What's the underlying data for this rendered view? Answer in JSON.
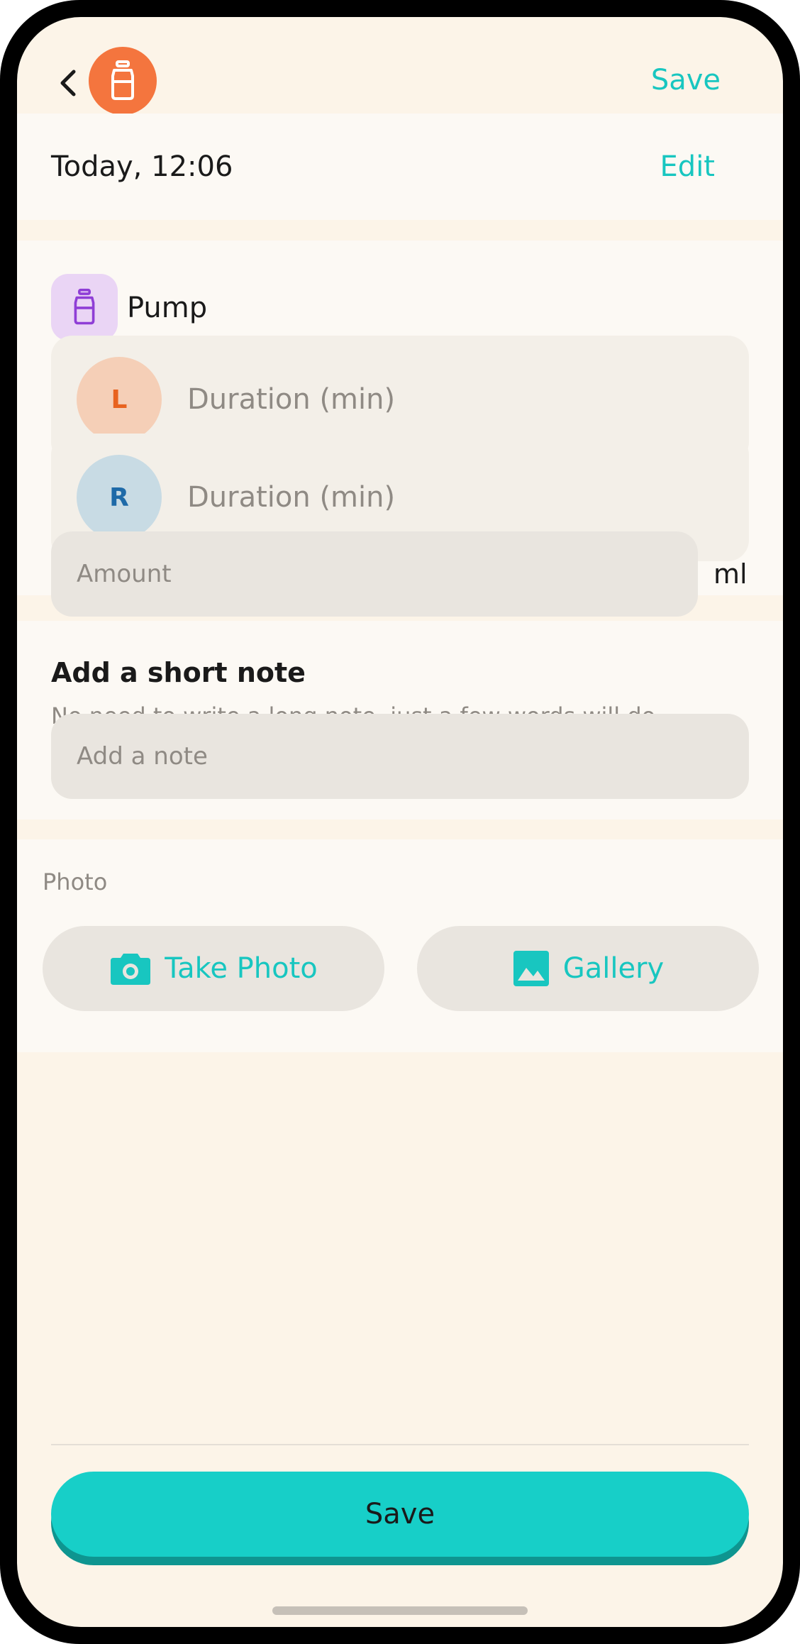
{
  "header": {
    "back_icon": "chevron-left-icon",
    "app_icon": "pump-bottle-icon",
    "save_label": "Save"
  },
  "time_row": {
    "date_time": "Today, 12:06",
    "edit_label": "Edit"
  },
  "pump": {
    "icon": "pump-bottle-icon",
    "label": "Pump",
    "left": {
      "side_label": "L",
      "placeholder": "Duration (min)"
    },
    "right": {
      "side_label": "R",
      "placeholder": "Duration (min)"
    },
    "amount": {
      "placeholder": "Amount",
      "unit": "ml"
    }
  },
  "note": {
    "title": "Add a short note",
    "subtitle": "No need to write a long note, just a few words will do",
    "placeholder": "Add a note"
  },
  "photo": {
    "label": "Photo",
    "take_photo_label": "Take Photo",
    "take_photo_icon": "camera-icon",
    "gallery_label": "Gallery",
    "gallery_icon": "image-icon"
  },
  "footer": {
    "save_label": "Save"
  },
  "colors": {
    "accent": "#18c6c0",
    "save_button": "#17cfc8",
    "app_icon_bg": "#f4753e",
    "pump_icon_bg": "#ead5f5",
    "pump_icon": "#8f3ed6",
    "left_circle_bg": "#f5cfb7",
    "left_letter": "#e8631f",
    "right_circle_bg": "#c8dbe4",
    "right_letter": "#1e6aa8"
  }
}
